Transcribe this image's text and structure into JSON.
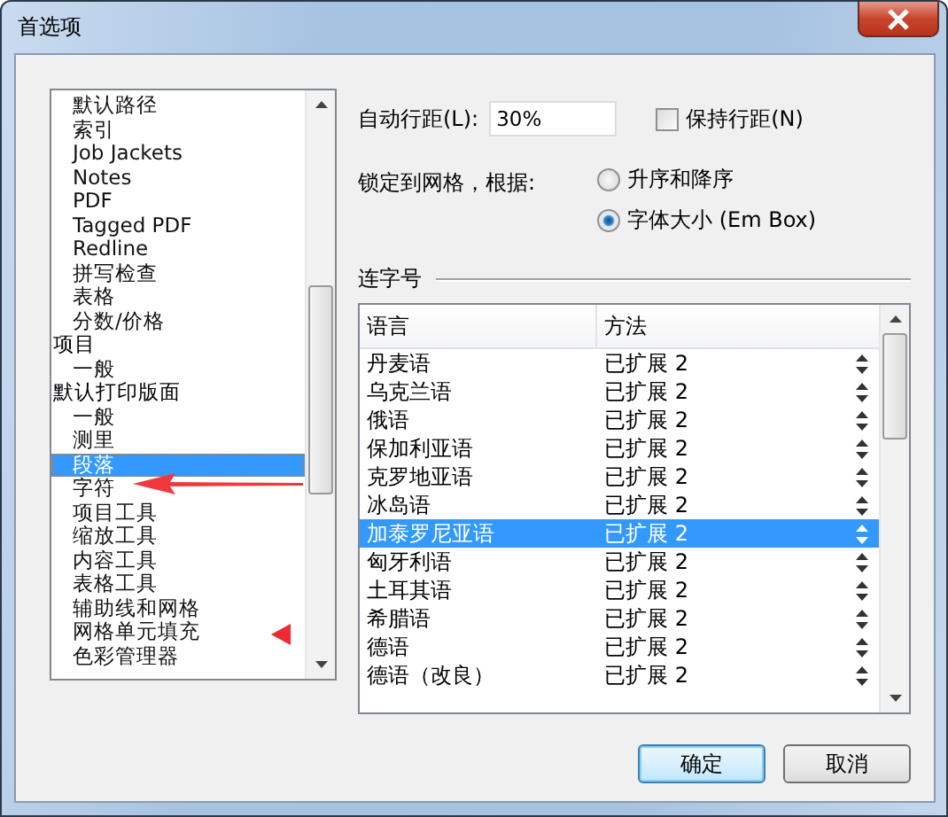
{
  "window": {
    "title": "首选项"
  },
  "sidebar": {
    "items": [
      {
        "children": [
          {
            "label": "默认路径",
            "selected": false
          },
          {
            "label": "索引",
            "selected": false
          },
          {
            "label": "Job Jackets",
            "selected": false
          },
          {
            "label": "Notes",
            "selected": false
          },
          {
            "label": "PDF",
            "selected": false
          },
          {
            "label": "Tagged PDF",
            "selected": false
          },
          {
            "label": "Redline",
            "selected": false
          },
          {
            "label": "拼写检查",
            "selected": false
          },
          {
            "label": "表格",
            "selected": false
          },
          {
            "label": "分数/价格",
            "selected": false
          }
        ]
      },
      {
        "label": "项目",
        "selected": false,
        "children": [
          {
            "label": "一般",
            "selected": false
          }
        ]
      },
      {
        "label": "默认打印版面",
        "selected": false,
        "children": [
          {
            "label": "一般",
            "selected": false
          },
          {
            "label": "测里",
            "selected": false
          },
          {
            "label": "段落",
            "selected": true
          },
          {
            "label": "字符",
            "selected": false
          },
          {
            "label": "项目工具",
            "selected": false
          },
          {
            "label": "缩放工具",
            "selected": false
          },
          {
            "label": "内容工具",
            "selected": false
          },
          {
            "label": "表格工具",
            "selected": false
          },
          {
            "label": "辅助线和网格",
            "selected": false
          },
          {
            "label": "网格单元填充",
            "selected": false
          },
          {
            "label": "色彩管理器",
            "selected": false
          }
        ]
      }
    ]
  },
  "auto_leading": {
    "label": "自动行距(L):",
    "value": "30%"
  },
  "keep_leading": {
    "label": "保持行距(N)",
    "checked": false
  },
  "lock_to_grid": {
    "label": "锁定到网格，根据:",
    "options": [
      {
        "label": "升序和降序",
        "selected": false
      },
      {
        "label": "字体大小 (Em Box)",
        "selected": true
      }
    ]
  },
  "hyphenation": {
    "title": "连字号",
    "table": {
      "columns": [
        "语言",
        "方法"
      ],
      "rows": [
        {
          "language": "丹麦语",
          "method": "已扩展 2",
          "selected": false
        },
        {
          "language": "乌克兰语",
          "method": "已扩展 2",
          "selected": false
        },
        {
          "language": "俄语",
          "method": "已扩展 2",
          "selected": false
        },
        {
          "language": "保加利亚语",
          "method": "已扩展 2",
          "selected": false
        },
        {
          "language": "克罗地亚语",
          "method": "已扩展 2",
          "selected": false
        },
        {
          "language": "冰岛语",
          "method": "已扩展 2",
          "selected": false
        },
        {
          "language": "加泰罗尼亚语",
          "method": "已扩展 2",
          "selected": true
        },
        {
          "language": "匈牙利语",
          "method": "已扩展 2",
          "selected": false
        },
        {
          "language": "土耳其语",
          "method": "已扩展 2",
          "selected": false
        },
        {
          "language": "希腊语",
          "method": "已扩展 2",
          "selected": false
        },
        {
          "language": "德语",
          "method": "已扩展 2",
          "selected": false
        },
        {
          "language": "德语（改良）",
          "method": "已扩展 2",
          "selected": false
        }
      ]
    }
  },
  "buttons": [
    "确定",
    "取消"
  ]
}
